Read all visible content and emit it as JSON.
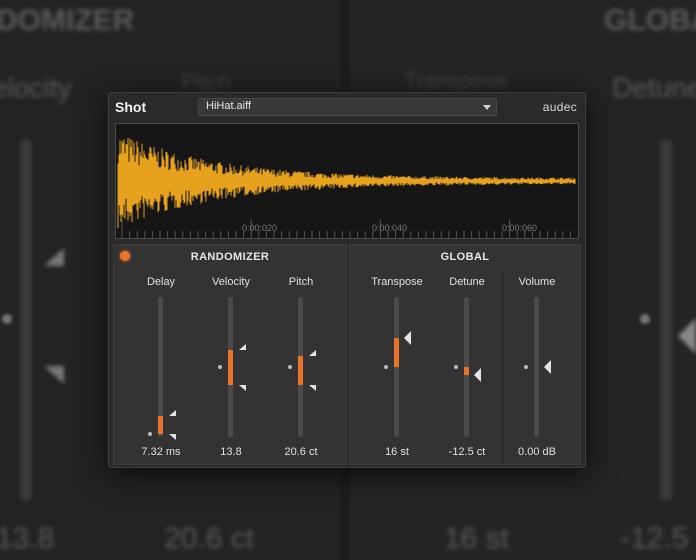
{
  "plugin": {
    "title": "Shot",
    "file": "HiHat.aiff",
    "brand": "audec"
  },
  "waveform": {
    "color": "#e6a21c",
    "time_labels": [
      "0:00:020",
      "0:00:040",
      "0:00:060"
    ]
  },
  "randomizer": {
    "title": "RANDOMIZER",
    "led_color": "#e8732a",
    "sliders": [
      {
        "label": "Delay",
        "value": "7.32 ms",
        "range_from": 0.02,
        "range_to": 0.15,
        "center": 0.02
      },
      {
        "label": "Velocity",
        "value": "13.8",
        "range_from": 0.37,
        "range_to": 0.62,
        "center": 0.5
      },
      {
        "label": "Pitch",
        "value": "20.6 ct",
        "range_from": 0.37,
        "range_to": 0.58,
        "center": 0.5
      }
    ]
  },
  "global": {
    "title": "GLOBAL",
    "sliders": [
      {
        "label": "Transpose",
        "value": "16 st",
        "level": 0.71
      },
      {
        "label": "Detune",
        "value": "-12.5 ct",
        "level": 0.44
      },
      {
        "label": "Volume",
        "value": "0.00 dB",
        "level": 0.5
      }
    ]
  },
  "backdrop": {
    "labels": [
      "DOMIZER",
      "elocity",
      "Pitch",
      "Transpose",
      "GLOBAL",
      "Detune",
      "13.8",
      "20.6 ct",
      "16 st",
      "-12.5"
    ]
  }
}
